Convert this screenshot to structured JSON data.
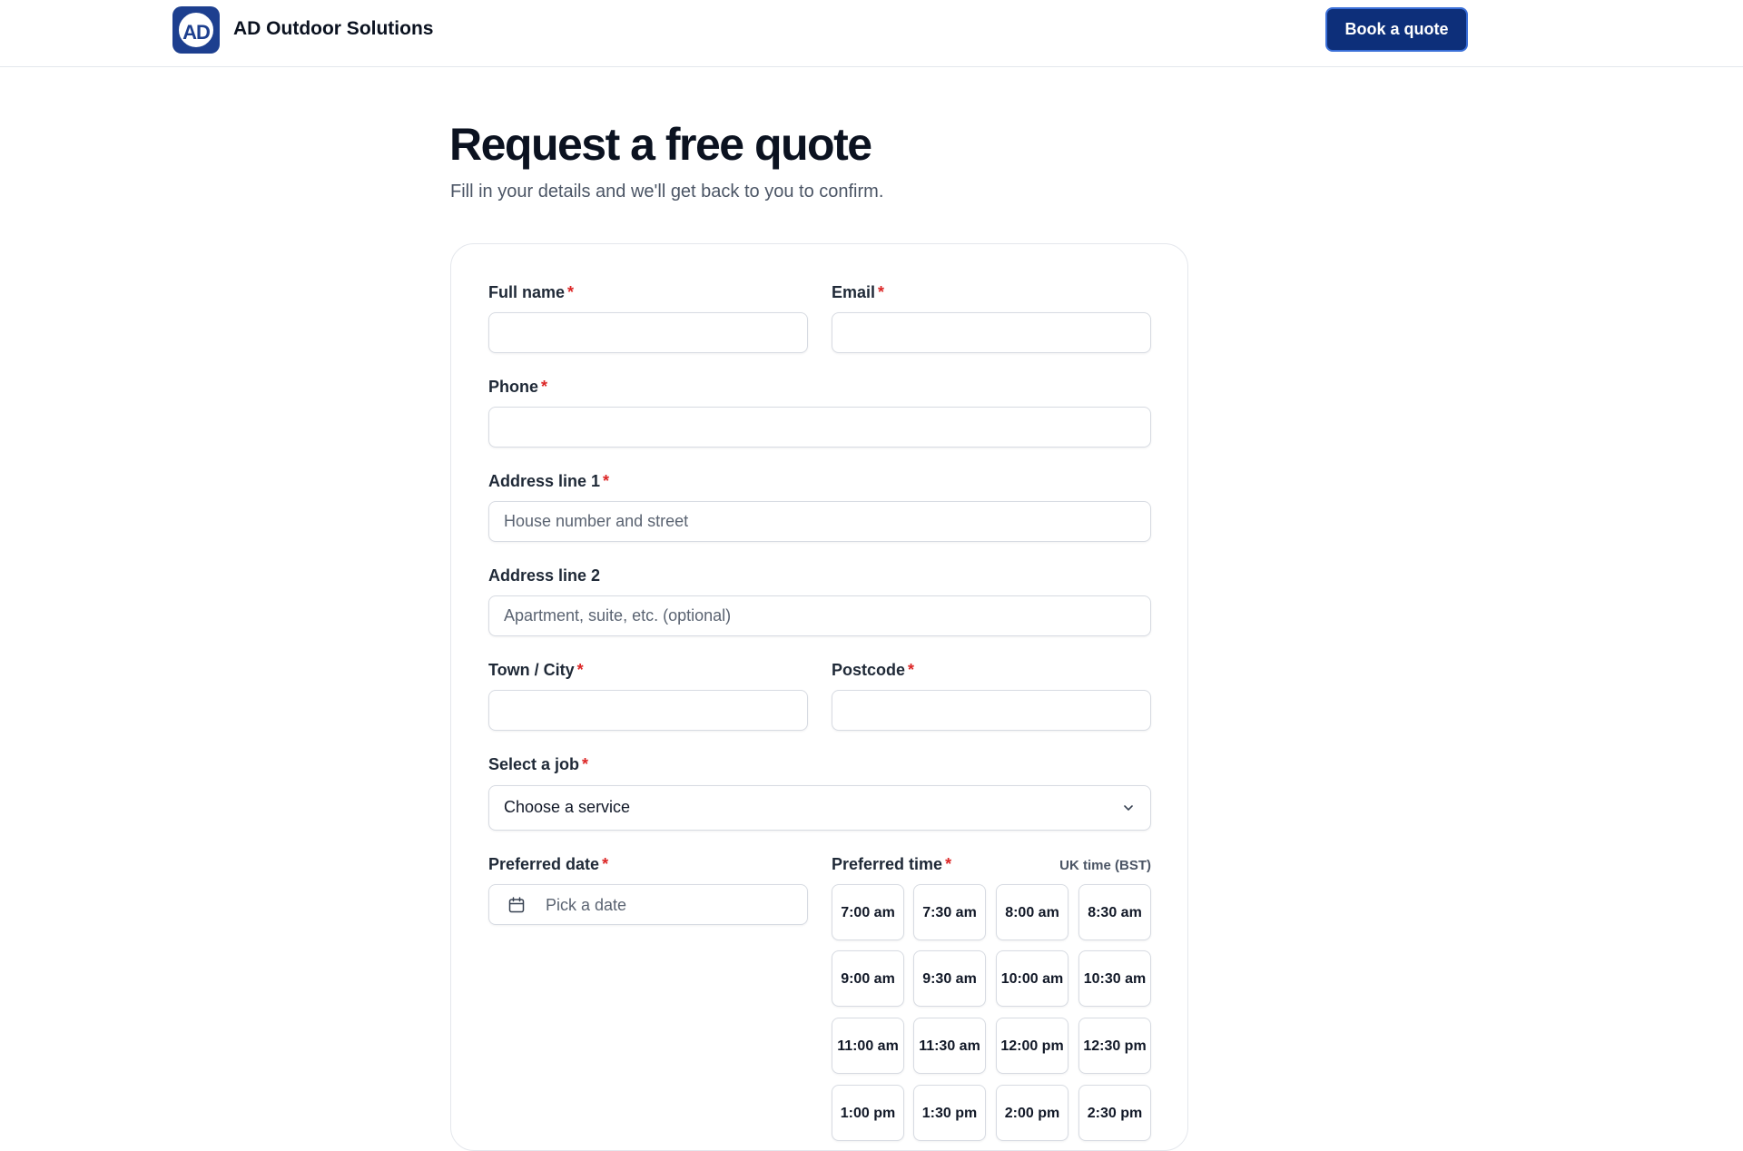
{
  "header": {
    "brand": "AD Outdoor Solutions",
    "logo_text": "AD",
    "cta_label": "Book a quote"
  },
  "page": {
    "title": "Request a free quote",
    "subtitle": "Fill in your details and we'll get back to you to confirm."
  },
  "form": {
    "required_mark": "*",
    "full_name": {
      "label": "Full name",
      "value": "",
      "placeholder": ""
    },
    "email": {
      "label": "Email",
      "value": "",
      "placeholder": ""
    },
    "phone": {
      "label": "Phone",
      "value": "",
      "placeholder": ""
    },
    "address1": {
      "label": "Address line 1",
      "value": "",
      "placeholder": "House number and street"
    },
    "address2": {
      "label": "Address line 2",
      "value": "",
      "placeholder": "Apartment, suite, etc. (optional)"
    },
    "town": {
      "label": "Town / City",
      "value": "",
      "placeholder": ""
    },
    "postcode": {
      "label": "Postcode",
      "value": "",
      "placeholder": ""
    },
    "job": {
      "label": "Select a job",
      "selected": "Choose a service"
    },
    "date": {
      "label": "Preferred date",
      "placeholder": "Pick a date"
    },
    "time": {
      "label": "Preferred time",
      "timezone": "UK time (BST)",
      "slots": [
        "7:00 am",
        "7:30 am",
        "8:00 am",
        "8:30 am",
        "9:00 am",
        "9:30 am",
        "10:00 am",
        "10:30 am",
        "11:00 am",
        "11:30 am",
        "12:00 pm",
        "12:30 pm",
        "1:00 pm",
        "1:30 pm",
        "2:00 pm",
        "2:30 pm"
      ]
    }
  },
  "colors": {
    "brand": "#1d3f8f",
    "cta_bg": "#0d2f7a",
    "required": "#dc2626"
  }
}
